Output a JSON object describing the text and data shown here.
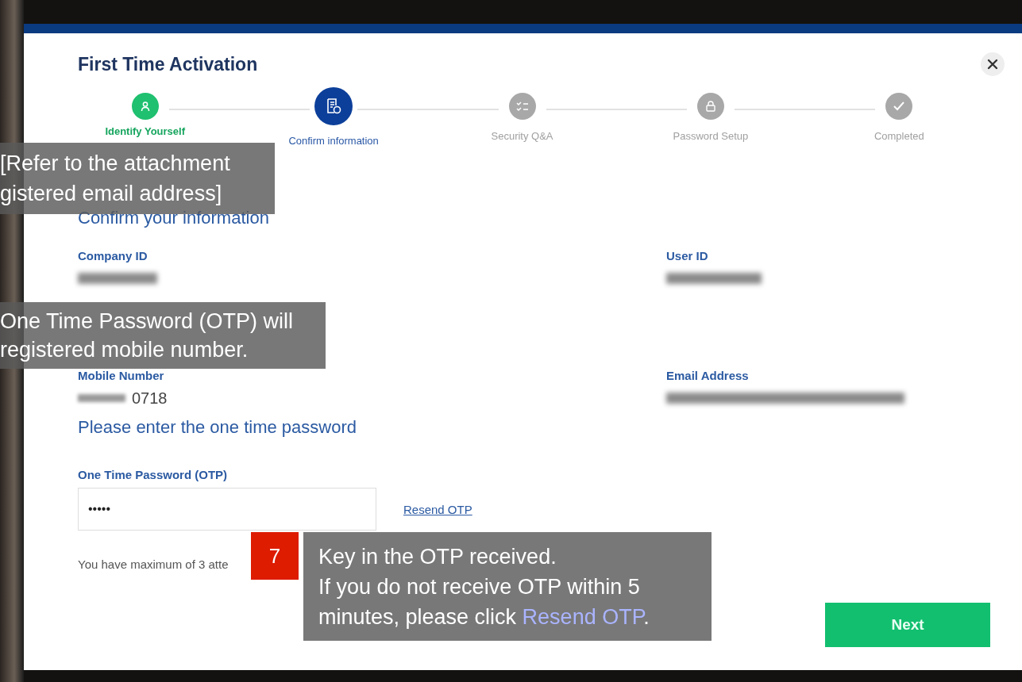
{
  "dialog": {
    "title": "First Time Activation"
  },
  "steps": [
    {
      "label": "Identify Yourself",
      "completed": true,
      "selected": false
    },
    {
      "label": "Confirm information",
      "completed": false,
      "selected": true
    },
    {
      "label": "Security Q&A",
      "completed": false,
      "selected": false
    },
    {
      "label": "Password Setup",
      "completed": false,
      "selected": false
    },
    {
      "label": "Completed",
      "completed": false,
      "selected": false
    }
  ],
  "confirm_section": {
    "heading": "Confirm your information",
    "fields": [
      {
        "label": "Company ID",
        "blurred": true
      },
      {
        "label": "User ID",
        "blurred": true
      },
      {
        "label": "Mobile Number",
        "blurred": false,
        "masked_prefix": true,
        "value": "0718"
      },
      {
        "label": "Email Address",
        "blurred": true
      }
    ]
  },
  "otp_section": {
    "heading": "Please enter the one time password",
    "label": "One Time Password (OTP)",
    "value": "•••••",
    "resend_link": "Resend OTP",
    "attempts_note": "You have maximum of 3 atte"
  },
  "next_button": "Next",
  "callouts": [
    {
      "lines": [
        "[Refer to the attachment",
        "gistered email address]"
      ]
    },
    {
      "lines": [
        "One Time Password (OTP) will",
        "registered mobile number."
      ]
    }
  ],
  "step_callout": {
    "number": "7",
    "lines": [
      "Key in the OTP received.",
      "If you do not receive OTP within 5"
    ],
    "last_line_before": "minutes, please click ",
    "highlight": "Resend OTP",
    "last_line_after": "."
  }
}
